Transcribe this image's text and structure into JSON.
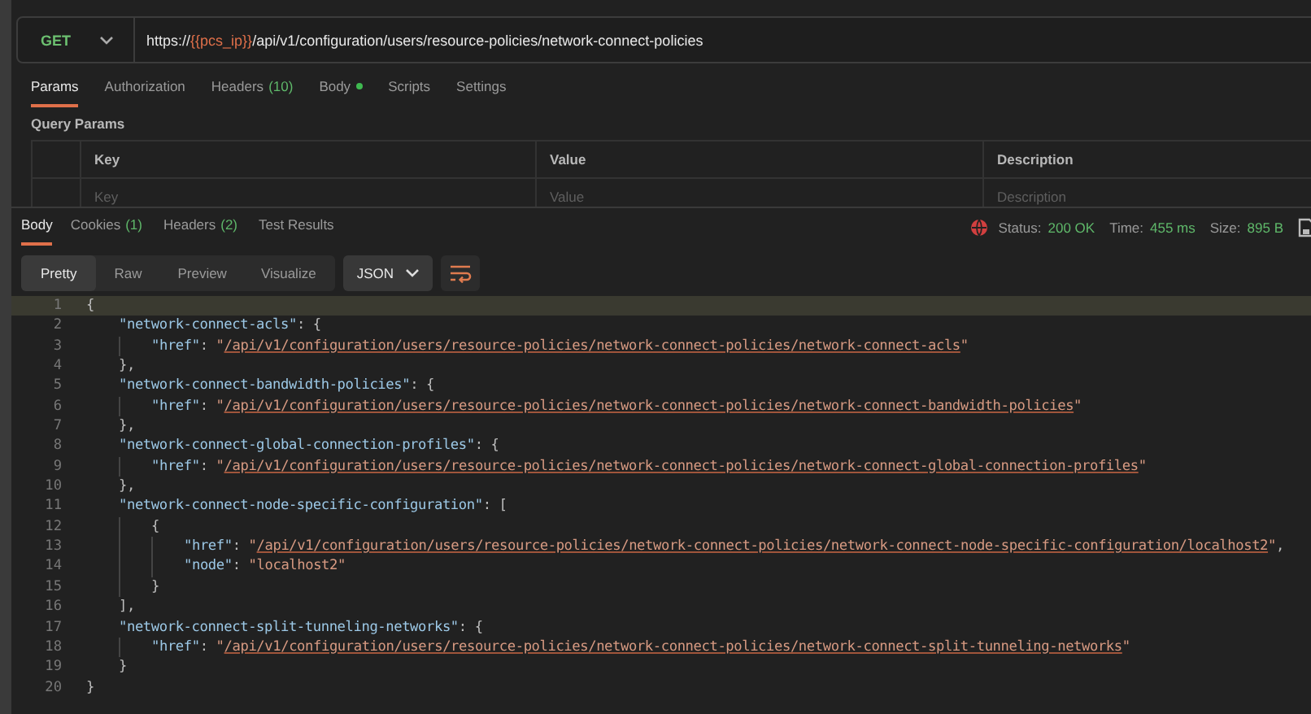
{
  "request": {
    "method": "GET",
    "url": [
      {
        "kind": "text",
        "text": "https://"
      },
      {
        "kind": "variable",
        "text": "{{pcs_ip}}"
      },
      {
        "kind": "text",
        "text": "/api/v1/configuration/users/resource-policies/network-connect-policies"
      }
    ]
  },
  "request_tabs": [
    {
      "label": "Params",
      "dot": false,
      "selected": true
    },
    {
      "label": "Authorization",
      "dot": false,
      "selected": false
    },
    {
      "label": "Headers",
      "count": "(10)",
      "dot": false,
      "selected": false
    },
    {
      "label": "Body",
      "dot": true,
      "selected": false
    },
    {
      "label": "Scripts",
      "dot": false,
      "selected": false
    },
    {
      "label": "Settings",
      "dot": false,
      "selected": false
    }
  ],
  "query_params": {
    "title": "Query Params",
    "columns": [
      "Key",
      "Value",
      "Description"
    ],
    "placeholders": [
      "Key",
      "Value",
      "Description"
    ]
  },
  "response_tabs": [
    {
      "label": "Body",
      "selected": true
    },
    {
      "label": "Cookies",
      "count": "(1)",
      "selected": false
    },
    {
      "label": "Headers",
      "count": "(2)",
      "selected": false
    },
    {
      "label": "Test Results",
      "selected": false
    }
  ],
  "response_status": [
    {
      "label": "Status:",
      "value": "200 OK"
    },
    {
      "label": "Time:",
      "value": "455 ms"
    },
    {
      "label": "Size:",
      "value": "895 B"
    }
  ],
  "view_modes": [
    {
      "label": "Pretty",
      "selected": true
    },
    {
      "label": "Raw",
      "selected": false
    },
    {
      "label": "Preview",
      "selected": false
    },
    {
      "label": "Visualize",
      "selected": false
    }
  ],
  "format": "JSON",
  "code_lines": [
    {
      "number": "1",
      "current": true,
      "tokens": [
        {
          "kind": "punct",
          "text": "{"
        }
      ],
      "children": [
        {
          "number": "2",
          "current": false,
          "tokens": [
            {
              "kind": "key",
              "text": "\"network-connect-acls\""
            },
            {
              "kind": "punct",
              "text": ": {"
            }
          ],
          "children": [
            {
              "number": "3",
              "current": false,
              "tokens": [
                {
                  "kind": "key",
                  "text": "\"href\""
                },
                {
                  "kind": "punct",
                  "text": ": "
                },
                {
                  "kind": "string",
                  "text": "\""
                },
                {
                  "kind": "link",
                  "text": "/api/v1/configuration/users/resource-policies/network-connect-policies/network-connect-acls"
                },
                {
                  "kind": "string",
                  "text": "\""
                }
              ]
            }
          ]
        },
        {
          "number": "4",
          "current": false,
          "tokens": [
            {
              "kind": "punct",
              "text": "},"
            }
          ]
        },
        {
          "number": "5",
          "current": false,
          "tokens": [
            {
              "kind": "key",
              "text": "\"network-connect-bandwidth-policies\""
            },
            {
              "kind": "punct",
              "text": ": {"
            }
          ],
          "children": [
            {
              "number": "6",
              "current": false,
              "tokens": [
                {
                  "kind": "key",
                  "text": "\"href\""
                },
                {
                  "kind": "punct",
                  "text": ": "
                },
                {
                  "kind": "string",
                  "text": "\""
                },
                {
                  "kind": "link",
                  "text": "/api/v1/configuration/users/resource-policies/network-connect-policies/network-connect-bandwidth-policies"
                },
                {
                  "kind": "string",
                  "text": "\""
                }
              ]
            }
          ]
        },
        {
          "number": "7",
          "current": false,
          "tokens": [
            {
              "kind": "punct",
              "text": "},"
            }
          ]
        },
        {
          "number": "8",
          "current": false,
          "tokens": [
            {
              "kind": "key",
              "text": "\"network-connect-global-connection-profiles\""
            },
            {
              "kind": "punct",
              "text": ": {"
            }
          ],
          "children": [
            {
              "number": "9",
              "current": false,
              "tokens": [
                {
                  "kind": "key",
                  "text": "\"href\""
                },
                {
                  "kind": "punct",
                  "text": ": "
                },
                {
                  "kind": "string",
                  "text": "\""
                },
                {
                  "kind": "link",
                  "text": "/api/v1/configuration/users/resource-policies/network-connect-policies/network-connect-global-connection-profiles"
                },
                {
                  "kind": "string",
                  "text": "\""
                }
              ]
            }
          ]
        },
        {
          "number": "10",
          "current": false,
          "tokens": [
            {
              "kind": "punct",
              "text": "},"
            }
          ]
        },
        {
          "number": "11",
          "current": false,
          "tokens": [
            {
              "kind": "key",
              "text": "\"network-connect-node-specific-configuration\""
            },
            {
              "kind": "punct",
              "text": ": ["
            }
          ],
          "children": [
            {
              "number": "12",
              "current": false,
              "tokens": [
                {
                  "kind": "punct",
                  "text": "{"
                }
              ],
              "children": [
                {
                  "number": "13",
                  "current": false,
                  "tokens": [
                    {
                      "kind": "key",
                      "text": "\"href\""
                    },
                    {
                      "kind": "punct",
                      "text": ": "
                    },
                    {
                      "kind": "string",
                      "text": "\""
                    },
                    {
                      "kind": "link",
                      "text": "/api/v1/configuration/users/resource-policies/network-connect-policies/network-connect-node-specific-configuration/localhost2"
                    },
                    {
                      "kind": "string",
                      "text": "\""
                    },
                    {
                      "kind": "punct",
                      "text": ","
                    }
                  ]
                },
                {
                  "number": "14",
                  "current": false,
                  "tokens": [
                    {
                      "kind": "key",
                      "text": "\"node\""
                    },
                    {
                      "kind": "punct",
                      "text": ": "
                    },
                    {
                      "kind": "string",
                      "text": "\"localhost2\""
                    }
                  ]
                }
              ]
            },
            {
              "number": "15",
              "current": false,
              "tokens": [
                {
                  "kind": "punct",
                  "text": "}"
                }
              ]
            }
          ]
        },
        {
          "number": "16",
          "current": false,
          "tokens": [
            {
              "kind": "punct",
              "text": "],"
            }
          ]
        },
        {
          "number": "17",
          "current": false,
          "tokens": [
            {
              "kind": "key",
              "text": "\"network-connect-split-tunneling-networks\""
            },
            {
              "kind": "punct",
              "text": ": {"
            }
          ],
          "children": [
            {
              "number": "18",
              "current": false,
              "tokens": [
                {
                  "kind": "key",
                  "text": "\"href\""
                },
                {
                  "kind": "punct",
                  "text": ": "
                },
                {
                  "kind": "string",
                  "text": "\""
                },
                {
                  "kind": "link",
                  "text": "/api/v1/configuration/users/resource-policies/network-connect-policies/network-connect-split-tunneling-networks"
                },
                {
                  "kind": "string",
                  "text": "\""
                }
              ]
            }
          ]
        },
        {
          "number": "19",
          "current": false,
          "tokens": [
            {
              "kind": "punct",
              "text": "}"
            }
          ]
        }
      ]
    },
    {
      "number": "20",
      "current": false,
      "tokens": [
        {
          "kind": "punct",
          "text": "}"
        }
      ]
    }
  ]
}
